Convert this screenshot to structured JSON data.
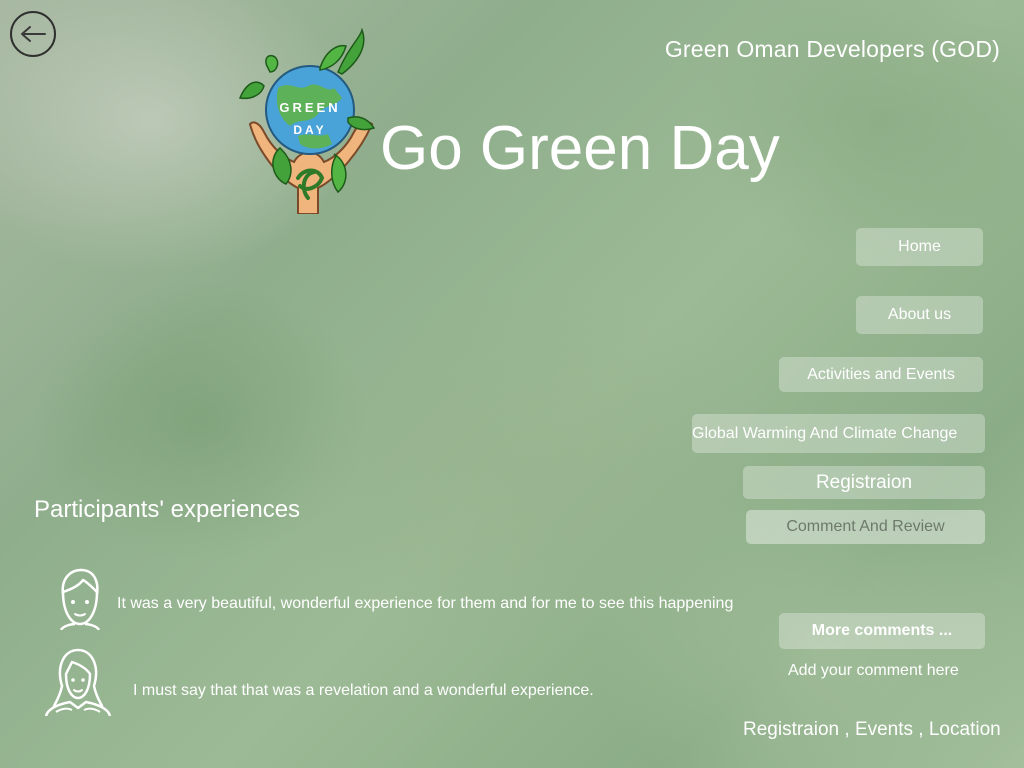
{
  "header": {
    "org_name": "Green Oman Developers (GOD)",
    "title": "Go Green Day",
    "back_icon": "back-arrow-icon",
    "logo_text_top": "GREEN",
    "logo_text_bottom": "DAY"
  },
  "nav": {
    "home": "Home",
    "about": "About us",
    "activities": "Activities and Events",
    "global": "Global Warming And Climate Change",
    "registration": "Registraion",
    "comment": "Comment And Review"
  },
  "experiences": {
    "title": "Participants' experiences",
    "items": [
      {
        "avatar": "male-avatar-icon",
        "text": "It was a very beautiful, wonderful experience for them and for me to see this happening"
      },
      {
        "avatar": "female-avatar-icon",
        "text": "I must say that that was a revelation and a wonderful experience."
      }
    ],
    "more_label": "More comments ...",
    "add_label": "Add your comment here"
  },
  "footer": {
    "links": "Registraion , Events , Location"
  },
  "colors": {
    "background": "#8fae8c",
    "button_bg": "rgba(255,255,255,0.30)",
    "text": "#ffffff",
    "comment_button_text": "#6d7a6a"
  }
}
